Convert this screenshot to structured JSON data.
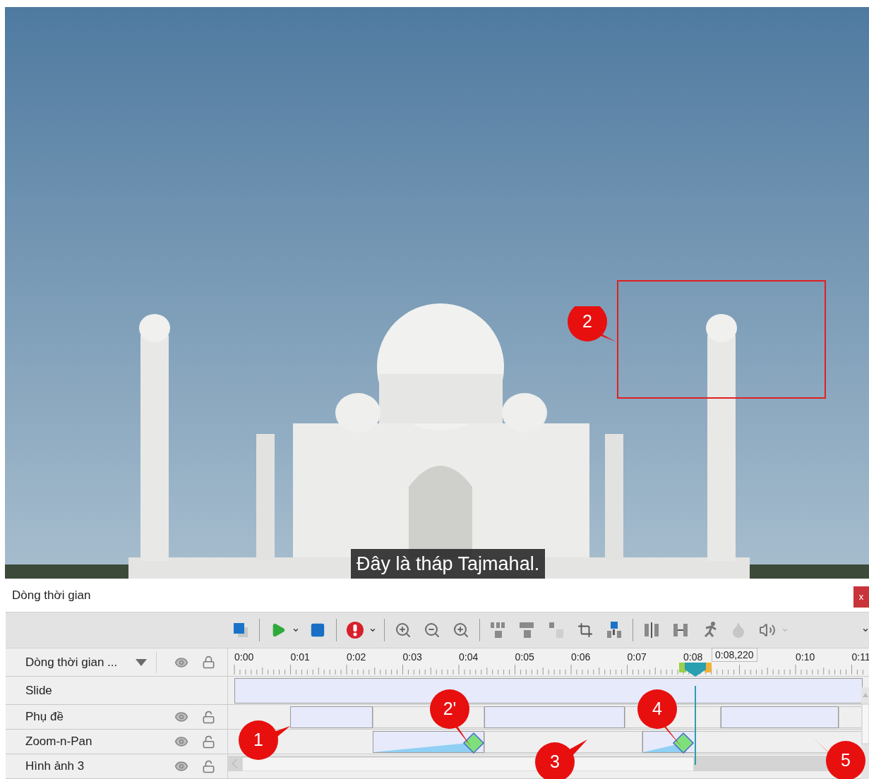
{
  "preview": {
    "caption": "Đây là tháp Tajmahal."
  },
  "annotations": [
    {
      "label": "2"
    },
    {
      "label": "1"
    },
    {
      "label": "2'"
    },
    {
      "label": "3"
    },
    {
      "label": "4"
    },
    {
      "label": "5"
    }
  ],
  "timeline": {
    "title": "Dòng thời gian",
    "close": "x",
    "header": {
      "label": "Dòng thời gian ...",
      "visible": true,
      "locked": true
    },
    "ruler": {
      "ticks": [
        "0:00",
        "0:01",
        "0:02",
        "0:03",
        "0:04",
        "0:05",
        "0:06",
        "0:07",
        "0:08",
        "0:10",
        "0:11"
      ],
      "current_time": "0:08,220"
    },
    "tracks": [
      {
        "name": "Slide",
        "kind": "slide"
      },
      {
        "name": "Phụ đề",
        "kind": "subtitle",
        "visible": true,
        "locked": false
      },
      {
        "name": "Zoom-n-Pan",
        "kind": "zoom",
        "visible": true,
        "locked": false
      },
      {
        "name": "Hình ảnh 3",
        "visible": true,
        "locked": false
      }
    ]
  }
}
